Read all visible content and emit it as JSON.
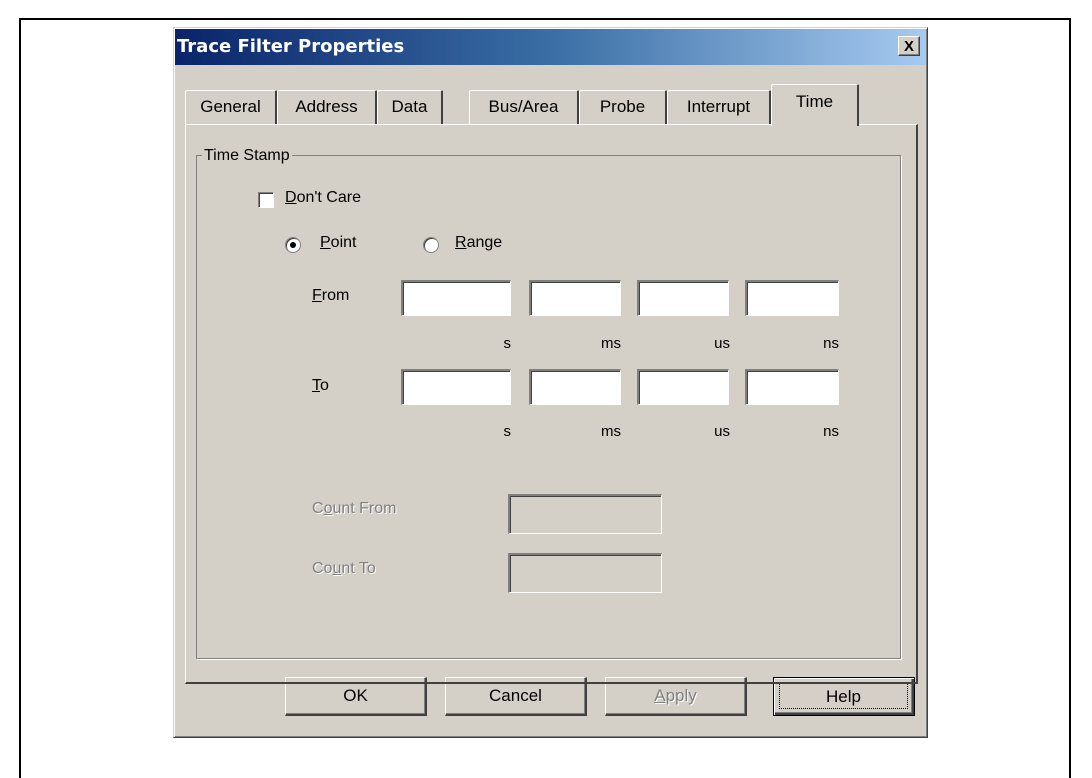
{
  "dialog": {
    "title": "Trace Filter Properties",
    "close_glyph": "X"
  },
  "tabs": [
    {
      "label": "General",
      "active": false
    },
    {
      "label": "Address",
      "active": false
    },
    {
      "label": "Data",
      "active": false
    },
    {
      "label": "Bus/Area",
      "active": false
    },
    {
      "label": "Probe",
      "active": false
    },
    {
      "label": "Interrupt",
      "active": false
    },
    {
      "label": "Time",
      "active": true
    }
  ],
  "time_stamp": {
    "group_label": "Time Stamp",
    "dont_care": {
      "label_mnemonic": "D",
      "label_rest": "on't Care",
      "checked": false
    },
    "point": {
      "label_mnemonic": "P",
      "label_rest": "oint",
      "selected": true
    },
    "range": {
      "label_mnemonic": "R",
      "label_rest": "ange",
      "selected": false
    },
    "from": {
      "label_mnemonic": "F",
      "label_rest": "rom",
      "values": [
        "",
        "",
        "",
        ""
      ],
      "units": [
        "s",
        "ms",
        "us",
        "ns"
      ]
    },
    "to": {
      "label_mnemonic": "T",
      "label_rest": "o",
      "values": [
        "",
        "",
        "",
        ""
      ],
      "units": [
        "s",
        "ms",
        "us",
        "ns"
      ]
    },
    "count_from": {
      "label_pre": "C",
      "label_mnemonic": "o",
      "label_rest": "unt From",
      "value": "",
      "enabled": false
    },
    "count_to": {
      "label_pre": "Co",
      "label_mnemonic": "u",
      "label_rest": "nt To",
      "value": "",
      "enabled": false
    }
  },
  "buttons": {
    "ok": "OK",
    "cancel": "Cancel",
    "apply_mnemonic": "A",
    "apply_rest": "pply",
    "help": "Help"
  },
  "colors": {
    "dialog_face": "#d4d0c8",
    "title_active_start": "#0a246a",
    "title_active_end": "#a6caf0",
    "disabled_text": "#808080"
  }
}
